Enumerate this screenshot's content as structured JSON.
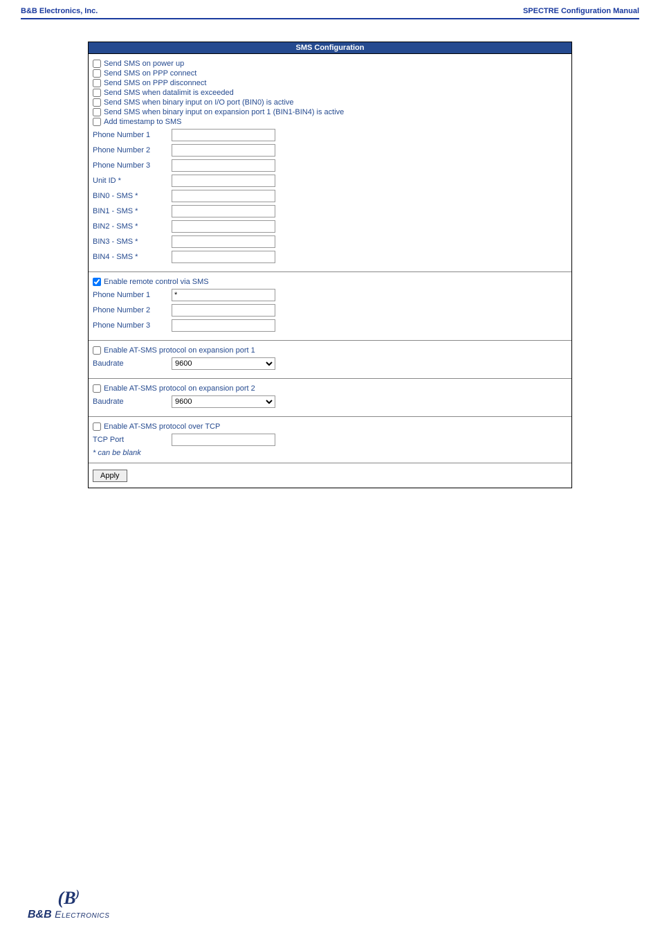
{
  "header": {
    "left": "B&B Electronics, Inc.",
    "right": "SPECTRE Configuration Manual"
  },
  "panel_title": "SMS Configuration",
  "section1": {
    "checks": [
      "Send SMS on power up",
      "Send SMS on PPP connect",
      "Send SMS on PPP disconnect",
      "Send SMS when datalimit is exceeded",
      "Send SMS when binary input on I/O port (BIN0) is active",
      "Send SMS when binary input on expansion port 1 (BIN1-BIN4) is active",
      "Add timestamp to SMS"
    ],
    "fields": [
      "Phone Number 1",
      "Phone Number 2",
      "Phone Number 3",
      "Unit ID *",
      "BIN0 - SMS *",
      "BIN1 - SMS *",
      "BIN2 - SMS *",
      "BIN3 - SMS *",
      "BIN4 - SMS *"
    ]
  },
  "section2": {
    "check": "Enable remote control via SMS",
    "checked": true,
    "fields": [
      {
        "label": "Phone Number 1",
        "value": "*"
      },
      {
        "label": "Phone Number 2",
        "value": ""
      },
      {
        "label": "Phone Number 3",
        "value": ""
      }
    ]
  },
  "section3": {
    "check": "Enable AT-SMS protocol on expansion port 1",
    "baud_label": "Baudrate",
    "baud_value": "9600"
  },
  "section4": {
    "check": "Enable AT-SMS protocol on expansion port 2",
    "baud_label": "Baudrate",
    "baud_value": "9600"
  },
  "section5": {
    "check": "Enable AT-SMS protocol over TCP",
    "field_label": "TCP Port",
    "note": "* can be blank"
  },
  "apply": "Apply",
  "footer": {
    "brand1": "B&B",
    "brand2": "Electronics"
  }
}
